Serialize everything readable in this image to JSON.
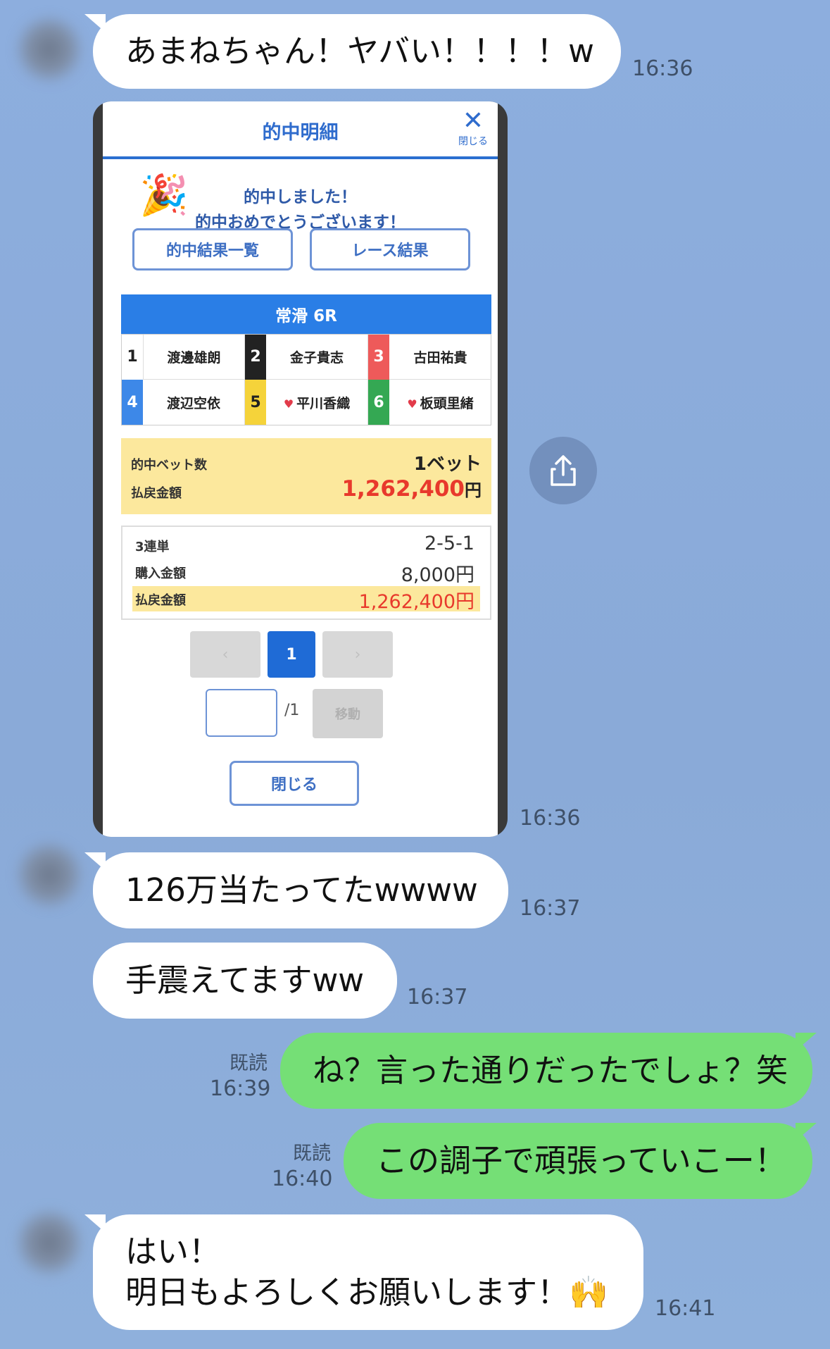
{
  "messages": [
    {
      "text": "あまねちゃん！ヤバい！！！！w",
      "time": "16:36"
    },
    {
      "time": "16:36"
    },
    {
      "text": "126万当たってたwwww",
      "time": "16:37"
    },
    {
      "text": "手震えてますww",
      "time": "16:37"
    },
    {
      "text": "ね？言った通りだったでしょ？笑",
      "read": "既読",
      "time": "16:39"
    },
    {
      "text": "この調子で頑張っていこー！",
      "read": "既読",
      "time": "16:40"
    },
    {
      "line1": "はい！",
      "line2": "明日もよろしくお願いします！",
      "emoji": "🙌",
      "time": "16:41"
    }
  ],
  "screenshot": {
    "title": "的中明細",
    "close_label": "閉じる",
    "congrats_line1": "的中しました！",
    "congrats_line2": "的中おめでとうございます！",
    "btn_results_list": "的中結果一覧",
    "btn_race_result": "レース結果",
    "race_title": "常滑 6R",
    "racers": [
      {
        "num": "1",
        "name": "渡邊雄朗"
      },
      {
        "num": "2",
        "name": "金子貴志"
      },
      {
        "num": "3",
        "name": "古田祐貴"
      },
      {
        "num": "4",
        "name": "渡辺空依"
      },
      {
        "num": "5",
        "name": "平川香織"
      },
      {
        "num": "6",
        "name": "板頭里緒"
      }
    ],
    "hit_bets_label": "的中ベット数",
    "hit_bets_value": "1ベット",
    "payout_label": "払戻金額",
    "payout_value": "1,262,400",
    "yen": "円",
    "bet_type_label": "3連単",
    "bet_combo": "2-5-1",
    "purchase_label": "購入金額",
    "purchase_value": "8,000円",
    "detail_payout_label": "払戻金額",
    "detail_payout_value": "1,262,400円",
    "page_prev": "‹",
    "page_current": "1",
    "page_next": "›",
    "page_total": "/1",
    "move_label": "移動",
    "close_button": "閉じる"
  },
  "colors": {
    "accent": "#2a7ee6",
    "green_bubble": "#75df76",
    "payout_red": "#e8392c"
  }
}
